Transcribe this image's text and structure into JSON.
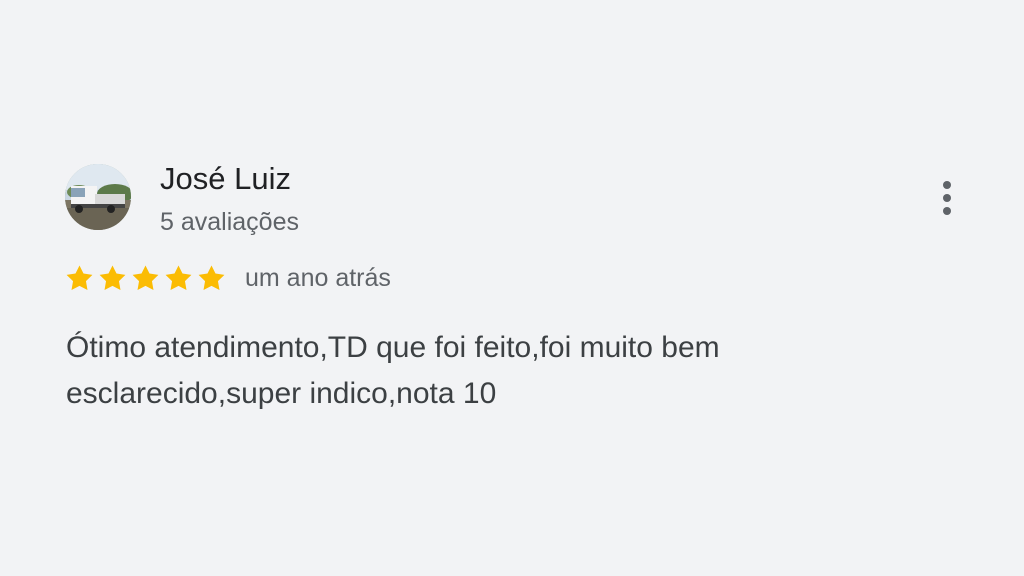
{
  "review": {
    "author_name": "José Luiz",
    "review_count": "5 avaliações",
    "rating": 5,
    "rating_max": 5,
    "date": "um ano atrás",
    "text": "Ótimo atendimento,TD que foi feito,foi muito bem esclarecido,super indico,nota 10"
  },
  "icons": {
    "star": "star-icon",
    "more": "more-vertical-icon",
    "avatar": "profile-photo"
  },
  "colors": {
    "background": "#f2f3f5",
    "star": "#fbbc04",
    "name": "#202124",
    "secondary": "#5f6368",
    "body_text": "#3c4043"
  }
}
